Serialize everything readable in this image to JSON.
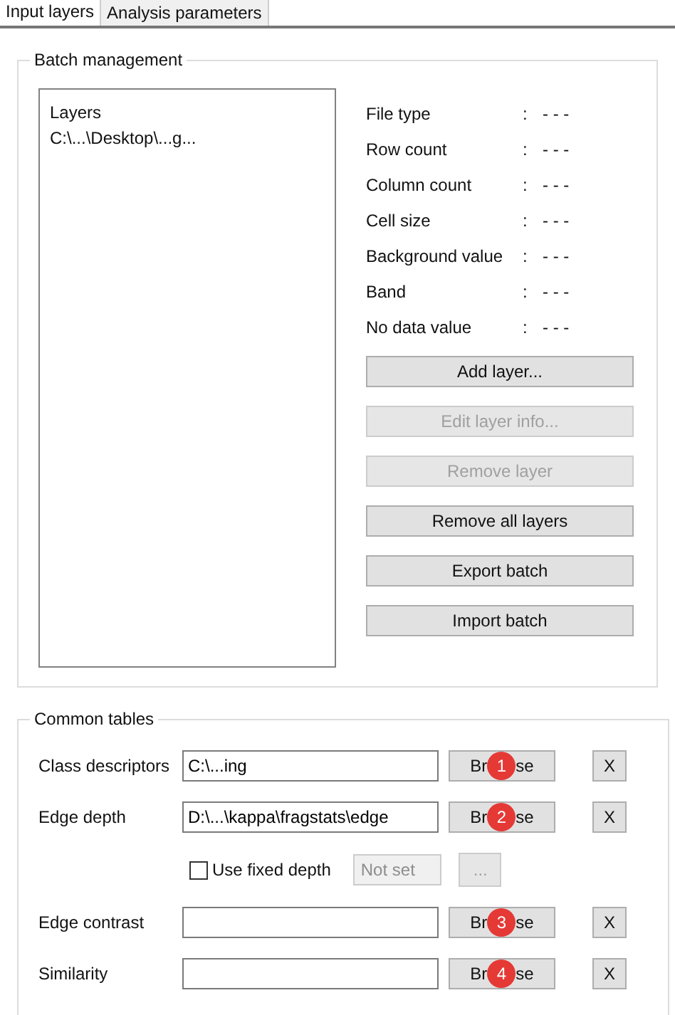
{
  "tabs": [
    {
      "label": "Input layers",
      "selected": true
    },
    {
      "label": "Analysis parameters",
      "selected": false
    }
  ],
  "batch_management": {
    "title": "Batch management",
    "layers_list": {
      "header": "Layers",
      "items": [
        "C:\\...\\Desktop\\...g..."
      ]
    },
    "properties": [
      {
        "label": "File type",
        "separator": ":",
        "value": "- - -"
      },
      {
        "label": "Row count",
        "separator": ":",
        "value": "- - -"
      },
      {
        "label": "Column count",
        "separator": ":",
        "value": "- - -"
      },
      {
        "label": "Cell size",
        "separator": ":",
        "value": "- - -"
      },
      {
        "label": "Background value",
        "separator": ":",
        "value": "- - -"
      },
      {
        "label": "Band",
        "separator": ":",
        "value": "- - -"
      },
      {
        "label": "No data value",
        "separator": ":",
        "value": "- - -"
      }
    ],
    "buttons": [
      {
        "label": "Add layer...",
        "disabled": false
      },
      {
        "label": "Edit layer info...",
        "disabled": true
      },
      {
        "label": "Remove layer",
        "disabled": true
      },
      {
        "label": "Remove all layers",
        "disabled": false
      },
      {
        "label": "Export batch",
        "disabled": false
      },
      {
        "label": "Import batch",
        "disabled": false
      }
    ]
  },
  "common_tables": {
    "title": "Common tables",
    "rows": [
      {
        "kind": "file",
        "label": "Class descriptors",
        "value": "C:\\...ing",
        "browse": [
          "Br",
          "se"
        ],
        "clear": "X",
        "badge": "1"
      },
      {
        "kind": "file",
        "label": "Edge depth",
        "value": "D:\\...\\kappa\\fragstats\\edge",
        "browse": [
          "Br",
          "se"
        ],
        "clear": "X",
        "badge": "2"
      },
      {
        "kind": "option",
        "label": "Use fixed depth",
        "checked": false,
        "value": "Not set",
        "button": "...",
        "disabled": true
      },
      {
        "kind": "file",
        "label": "Edge contrast",
        "value": "",
        "browse": [
          "Br",
          "se"
        ],
        "clear": "X",
        "badge": "3"
      },
      {
        "kind": "file",
        "label": "Similarity",
        "value": "",
        "browse": [
          "Br",
          "se"
        ],
        "clear": "X",
        "badge": "4"
      }
    ]
  }
}
